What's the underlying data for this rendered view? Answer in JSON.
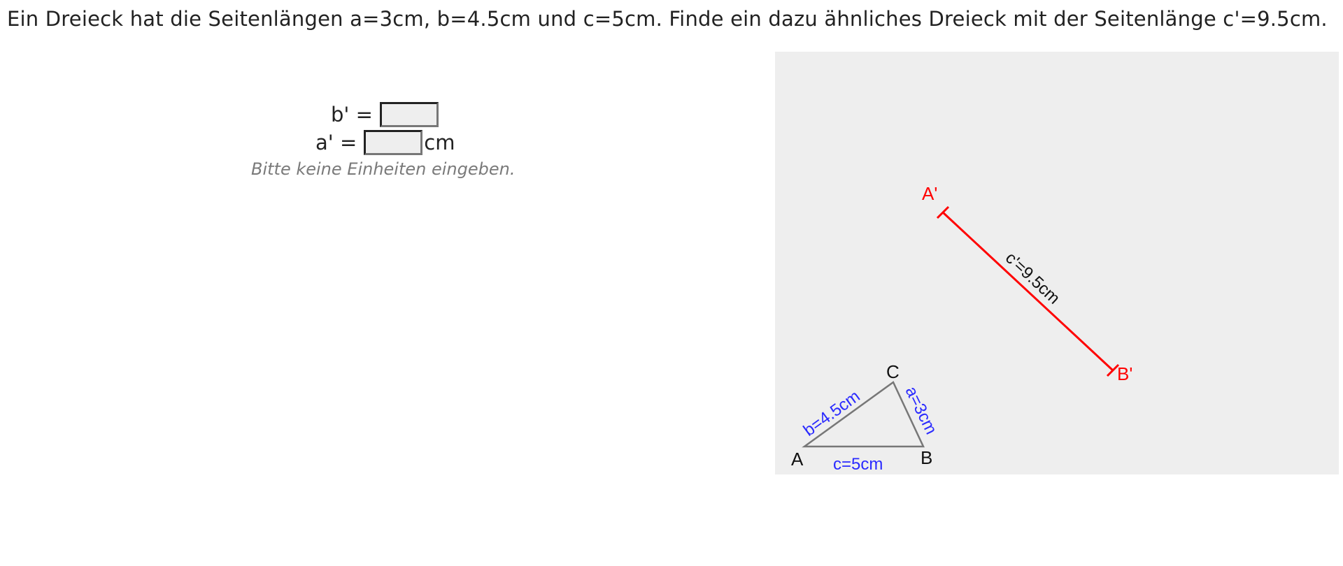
{
  "question": {
    "text": "Ein Dreieck hat die Seitenlängen a=3cm, b=4.5cm und c=5cm. Finde ein dazu ähnliches Dreieck mit der Seitenlänge c'=9.5cm."
  },
  "answers": {
    "b_prime": {
      "label": "b' =",
      "value": "",
      "unit": ""
    },
    "a_prime": {
      "label": "a' =",
      "value": "",
      "unit": "cm"
    },
    "hint": "Bitte keine Einheiten eingeben."
  },
  "figure": {
    "background": "#eeeeee",
    "original_triangle": {
      "vertex_A": "A",
      "vertex_B": "B",
      "vertex_C": "C",
      "side_a": "a=3cm",
      "side_b": "b=4.5cm",
      "side_c": "c=5cm",
      "stroke_color": "#777777",
      "side_label_color": "#2a2aff"
    },
    "scaled_segment": {
      "point_A": "A'",
      "point_B": "B'",
      "label": "c'=9.5cm",
      "color": "#ff0000"
    }
  }
}
